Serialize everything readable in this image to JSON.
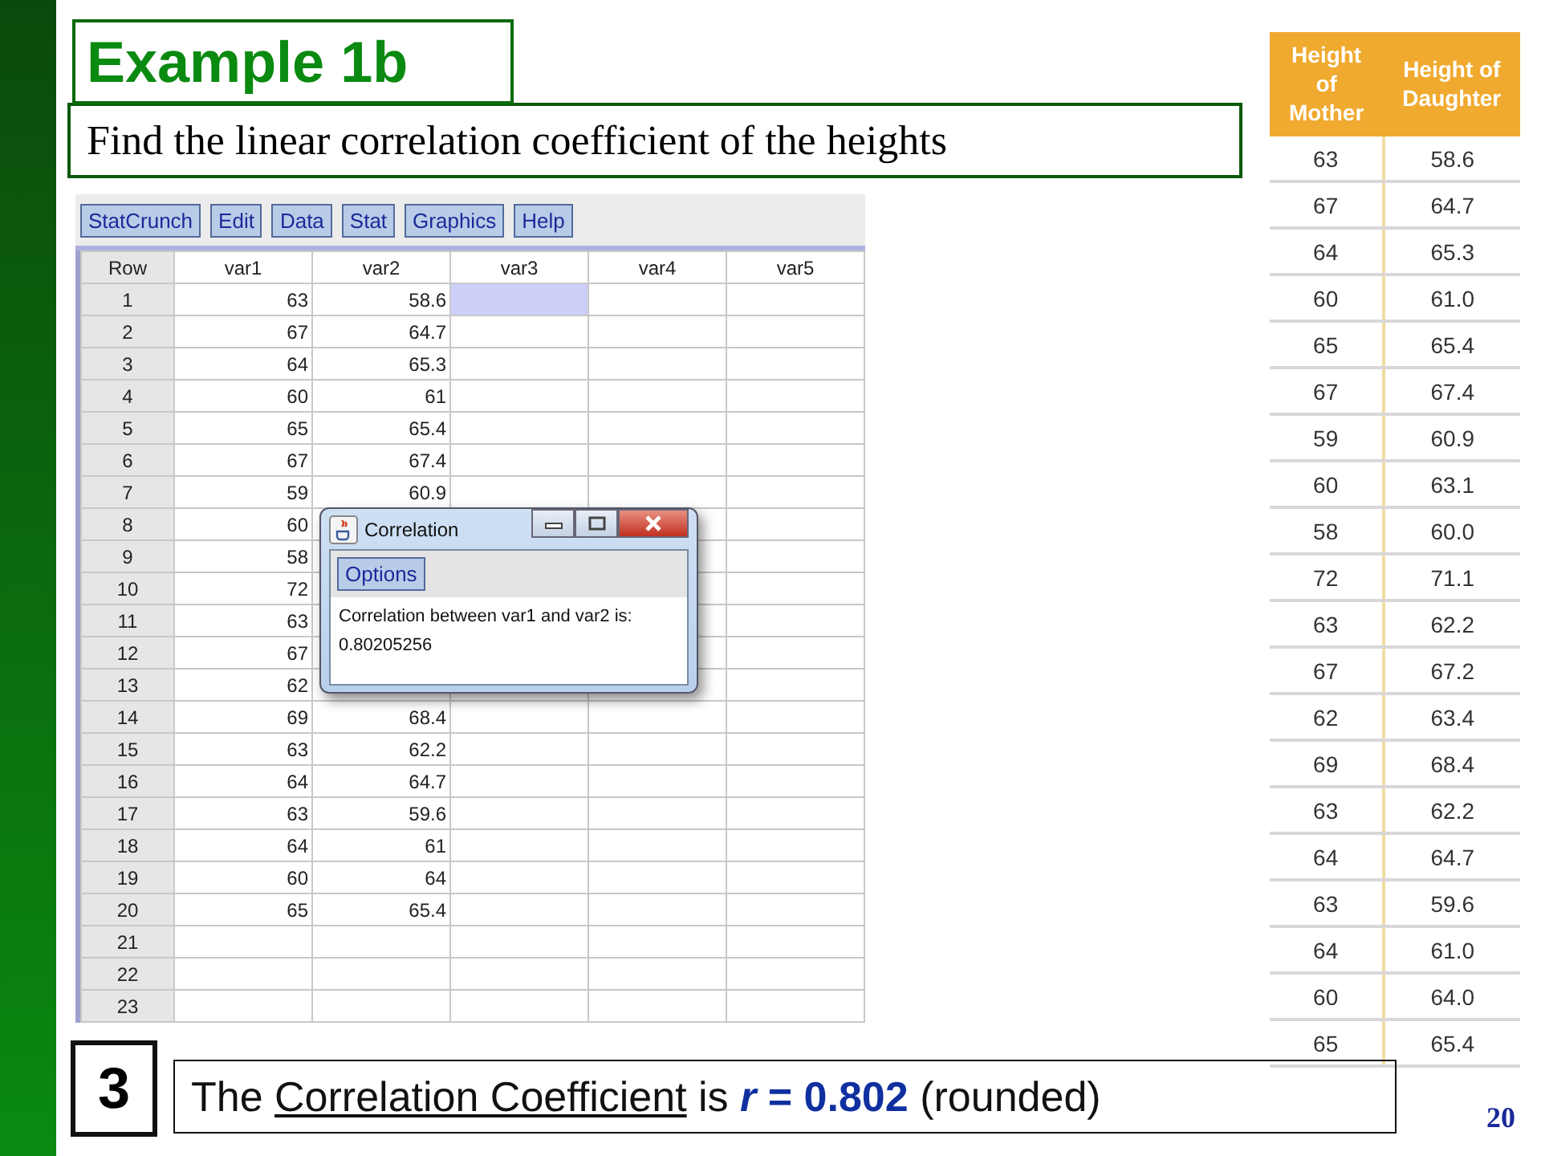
{
  "title": "Example 1b",
  "subtitle": "Find the linear correlation coefficient of the heights",
  "app": {
    "menu": [
      "StatCrunch",
      "Edit",
      "Data",
      "Stat",
      "Graphics",
      "Help"
    ],
    "columns": [
      "Row",
      "var1",
      "var2",
      "var3",
      "var4",
      "var5"
    ],
    "rows": [
      {
        "row": "1",
        "var1": "63",
        "var2": "58.6",
        "var3_selected": true
      },
      {
        "row": "2",
        "var1": "67",
        "var2": "64.7",
        "var3_selected": false
      },
      {
        "row": "3",
        "var1": "64",
        "var2": "65.3",
        "var3_selected": false
      },
      {
        "row": "4",
        "var1": "60",
        "var2": "61",
        "var3_selected": false
      },
      {
        "row": "5",
        "var1": "65",
        "var2": "65.4",
        "var3_selected": false
      },
      {
        "row": "6",
        "var1": "67",
        "var2": "67.4",
        "var3_selected": false
      },
      {
        "row": "7",
        "var1": "59",
        "var2": "60.9",
        "var3_selected": false
      },
      {
        "row": "8",
        "var1": "60"
      },
      {
        "row": "9",
        "var1": "58"
      },
      {
        "row": "10",
        "var1": "72"
      },
      {
        "row": "11",
        "var1": "63"
      },
      {
        "row": "12",
        "var1": "67"
      },
      {
        "row": "13",
        "var1": "62"
      },
      {
        "row": "14",
        "var1": "69",
        "var2": "68.4",
        "var3_selected": false
      },
      {
        "row": "15",
        "var1": "63",
        "var2": "62.2",
        "var3_selected": false
      },
      {
        "row": "16",
        "var1": "64",
        "var2": "64.7",
        "var3_selected": false
      },
      {
        "row": "17",
        "var1": "63",
        "var2": "59.6",
        "var3_selected": false
      },
      {
        "row": "18",
        "var1": "64",
        "var2": "61",
        "var3_selected": false
      },
      {
        "row": "19",
        "var1": "60",
        "var2": "64",
        "var3_selected": false
      },
      {
        "row": "20",
        "var1": "65",
        "var2": "65.4",
        "var3_selected": false
      },
      {
        "row": "21",
        "var3_selected": false
      },
      {
        "row": "22",
        "var3_selected": false
      },
      {
        "row": "23",
        "var3_selected": false
      }
    ],
    "dialog": {
      "title": "Correlation",
      "button": "Options",
      "lines": [
        "Correlation between var1 and var2 is:",
        "0.80205256"
      ]
    }
  },
  "heights_table": {
    "columns": [
      "Height of Mother",
      "Height of Daughter"
    ],
    "rows": [
      [
        "63",
        "58.6"
      ],
      [
        "67",
        "64.7"
      ],
      [
        "64",
        "65.3"
      ],
      [
        "60",
        "61.0"
      ],
      [
        "65",
        "65.4"
      ],
      [
        "67",
        "67.4"
      ],
      [
        "59",
        "60.9"
      ],
      [
        "60",
        "63.1"
      ],
      [
        "58",
        "60.0"
      ],
      [
        "72",
        "71.1"
      ],
      [
        "63",
        "62.2"
      ],
      [
        "67",
        "67.2"
      ],
      [
        "62",
        "63.4"
      ],
      [
        "69",
        "68.4"
      ],
      [
        "63",
        "62.2"
      ],
      [
        "64",
        "64.7"
      ],
      [
        "63",
        "59.6"
      ],
      [
        "64",
        "61.0"
      ],
      [
        "60",
        "64.0"
      ],
      [
        "65",
        "65.4"
      ]
    ]
  },
  "step": "3",
  "answer": [
    {
      "kind": "plain",
      "text": "The "
    },
    {
      "kind": "underline",
      "text": "Correlation Coefficient"
    },
    {
      "kind": "plain",
      "text": " is "
    },
    {
      "kind": "emphasis-italic",
      "text": "r"
    },
    {
      "kind": "emphasis",
      "text": " = 0.802"
    },
    {
      "kind": "plain",
      "text": " (rounded)"
    }
  ],
  "page_number": "20"
}
